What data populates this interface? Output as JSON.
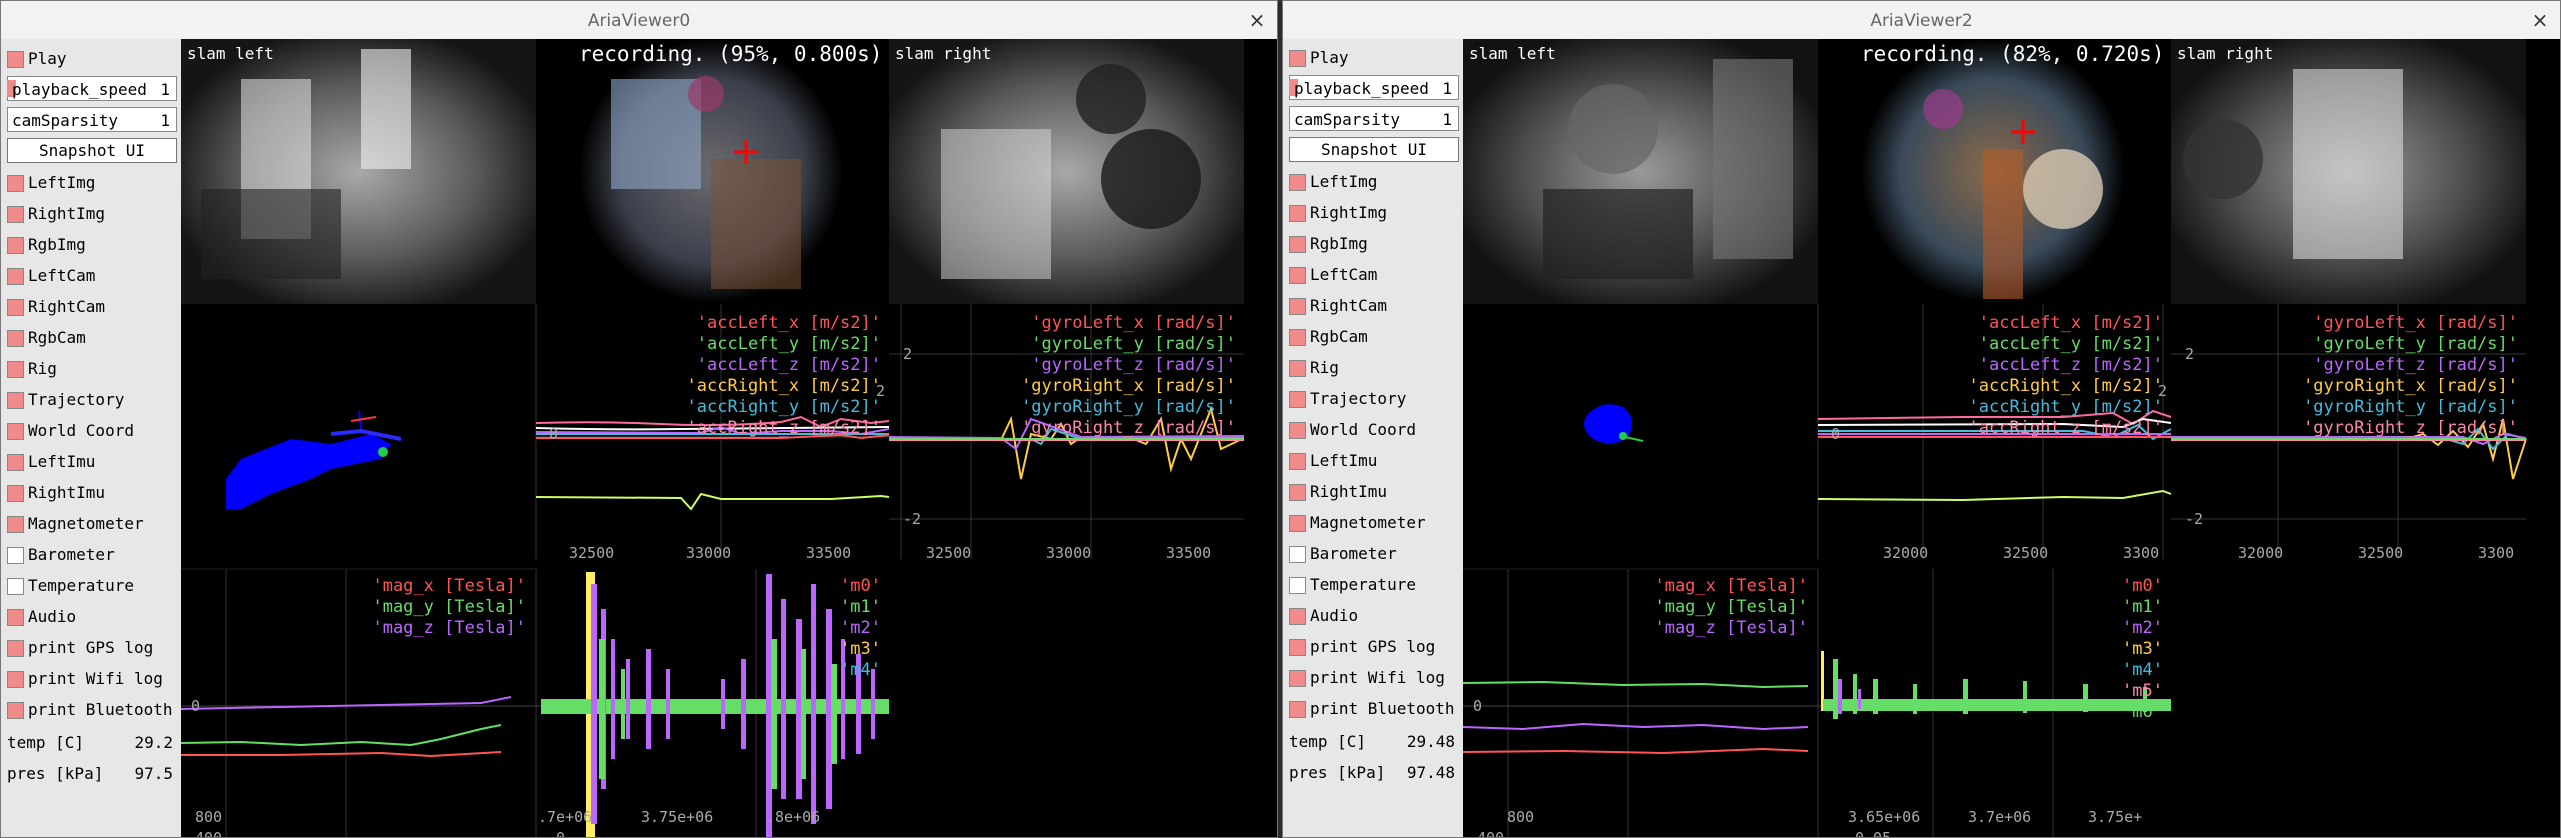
{
  "windows": [
    {
      "title": "AriaViewer0",
      "close": "×",
      "controls": {
        "play": "Play",
        "playback_speed_label": "playback_speed",
        "playback_speed_value": "1",
        "cam_sparsity_label": "camSparsity",
        "cam_sparsity_value": "1",
        "snapshot": "Snapshot UI",
        "toggles": [
          {
            "label": "LeftImg",
            "checked": true
          },
          {
            "label": "RightImg",
            "checked": true
          },
          {
            "label": "RgbImg",
            "checked": true
          },
          {
            "label": "LeftCam",
            "checked": true
          },
          {
            "label": "RightCam",
            "checked": true
          },
          {
            "label": "RgbCam",
            "checked": true
          },
          {
            "label": "Rig",
            "checked": true
          },
          {
            "label": "Trajectory",
            "checked": true
          },
          {
            "label": "World Coord",
            "checked": true
          },
          {
            "label": "LeftImu",
            "checked": true
          },
          {
            "label": "RightImu",
            "checked": true
          },
          {
            "label": "Magnetometer",
            "checked": true
          },
          {
            "label": "Barometer",
            "checked": false
          },
          {
            "label": "Temperature",
            "checked": false
          },
          {
            "label": "Audio",
            "checked": true
          },
          {
            "label": "print GPS log",
            "checked": true
          },
          {
            "label": "print Wifi log",
            "checked": true
          },
          {
            "label": "print Bluetooth",
            "checked": true
          }
        ],
        "temp_label": "temp [C]",
        "temp_value": "29.2",
        "pres_label": "pres [kPa]",
        "pres_value": "97.5"
      },
      "cams": {
        "slam_left": "slam left",
        "recording": "recording. (95%, 0.800s)",
        "slam_right": "slam right"
      },
      "acc_legend": [
        "'accLeft_x [m/s2]'",
        "'accLeft_y [m/s2]'",
        "'accLeft_z [m/s2]'",
        "'accRight_x [m/s2]'",
        "'accRight_y [m/s2]'",
        "'accRight_z [m/s2]'"
      ],
      "acc_ticks": {
        "x": [
          "32500",
          "33000",
          "33500"
        ],
        "y": [
          "2",
          "0"
        ]
      },
      "gyro_legend": [
        "'gyroLeft_x [rad/s]'",
        "'gyroLeft_y [rad/s]'",
        "'gyroLeft_z [rad/s]'",
        "'gyroRight_x [rad/s]'",
        "'gyroRight_y [rad/s]'",
        "'gyroRight_z [rad/s]'"
      ],
      "gyro_ticks": {
        "x": [
          "32500",
          "33000",
          "33500"
        ],
        "y": [
          "2",
          "-2"
        ]
      },
      "mag_legend": [
        "'mag_x [Tesla]'",
        "'mag_y [Tesla]'",
        "'mag_z [Tesla]'"
      ],
      "mag_ticks": {
        "x": [
          "800"
        ],
        "y": [
          "0"
        ],
        "bottom": "400"
      },
      "audio_legend": [
        "'m0'",
        "'m1'",
        "'m2'",
        "'m3'",
        "'m4'"
      ],
      "audio_ticks": {
        "x": [
          ".7e+06",
          "3.75e+06",
          ".8e+06"
        ],
        "bottom": "0"
      }
    },
    {
      "title": "AriaViewer2",
      "close": "×",
      "controls": {
        "play": "Play",
        "playback_speed_label": "playback_speed",
        "playback_speed_value": "1",
        "cam_sparsity_label": "camSparsity",
        "cam_sparsity_value": "1",
        "snapshot": "Snapshot UI",
        "toggles": [
          {
            "label": "LeftImg",
            "checked": true
          },
          {
            "label": "RightImg",
            "checked": true
          },
          {
            "label": "RgbImg",
            "checked": true
          },
          {
            "label": "LeftCam",
            "checked": true
          },
          {
            "label": "RightCam",
            "checked": true
          },
          {
            "label": "RgbCam",
            "checked": true
          },
          {
            "label": "Rig",
            "checked": true
          },
          {
            "label": "Trajectory",
            "checked": true
          },
          {
            "label": "World Coord",
            "checked": true
          },
          {
            "label": "LeftImu",
            "checked": true
          },
          {
            "label": "RightImu",
            "checked": true
          },
          {
            "label": "Magnetometer",
            "checked": true
          },
          {
            "label": "Barometer",
            "checked": false
          },
          {
            "label": "Temperature",
            "checked": false
          },
          {
            "label": "Audio",
            "checked": true
          },
          {
            "label": "print GPS log",
            "checked": true
          },
          {
            "label": "print Wifi log",
            "checked": true
          },
          {
            "label": "print Bluetooth",
            "checked": true
          }
        ],
        "temp_label": "temp [C]",
        "temp_value": "29.48",
        "pres_label": "pres [kPa]",
        "pres_value": "97.48"
      },
      "cams": {
        "slam_left": "slam left",
        "recording": "recording. (82%, 0.720s)",
        "slam_right": "slam right"
      },
      "acc_legend": [
        "'accLeft_x [m/s2]'",
        "'accLeft_y [m/s2]'",
        "'accLeft_z [m/s2]'",
        "'accRight_x [m/s2]'",
        "'accRight_y [m/s2]'",
        "'accRight_z [m/s2]'"
      ],
      "acc_ticks": {
        "x": [
          "32000",
          "32500",
          "3300"
        ],
        "y": [
          "2",
          "0"
        ]
      },
      "gyro_legend": [
        "'gyroLeft_x [rad/s]'",
        "'gyroLeft_y [rad/s]'",
        "'gyroLeft_z [rad/s]'",
        "'gyroRight_x [rad/s]'",
        "'gyroRight_y [rad/s]'",
        "'gyroRight_z [rad/s]'"
      ],
      "gyro_ticks": {
        "x": [
          "32000",
          "32500",
          "3300"
        ],
        "y": [
          "2",
          "-2"
        ]
      },
      "mag_legend": [
        "'mag_x [Tesla]'",
        "'mag_y [Tesla]'",
        "'mag_z [Tesla]'"
      ],
      "mag_ticks": {
        "x": [
          "800"
        ],
        "y": [
          "0"
        ],
        "bottom": "400"
      },
      "audio_legend": [
        "'m0'",
        "'m1'",
        "'m2'",
        "'m3'",
        "'m4'",
        "'m5'",
        "'m6'"
      ],
      "audio_ticks": {
        "x": [
          "3.65e+06",
          "3.7e+06",
          "3.75e+"
        ],
        "bottom": "0.05"
      }
    }
  ],
  "colors": {
    "x_axis": "#ff5555",
    "y_axis": "#66dd66",
    "z_axis": "#bb66ff",
    "right_x": "#ffcc44",
    "right_y": "#44bbdd",
    "right_z": "#ff88aa",
    "checkbox_on": "#ef8b8b",
    "trajectory": "#0000ff"
  }
}
